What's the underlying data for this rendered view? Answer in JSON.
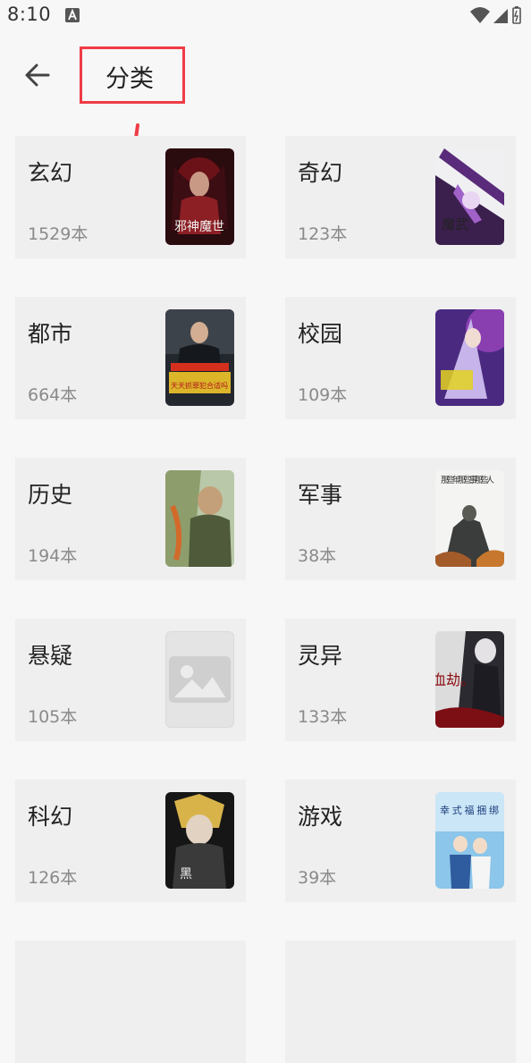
{
  "status_bar": {
    "time": "8:10",
    "icons": [
      "a-notification-icon",
      "wifi-icon",
      "signal-icon",
      "battery-icon"
    ]
  },
  "header": {
    "title": "分类",
    "back_icon": "arrow-left-icon"
  },
  "categories": [
    {
      "name": "玄幻",
      "count": "1529本",
      "cover_text": "邪神魔世"
    },
    {
      "name": "奇幻",
      "count": "123本",
      "cover_text": "魔武"
    },
    {
      "name": "都市",
      "count": "664本",
      "cover_text": "天天抓罪犯合适吗"
    },
    {
      "name": "校园",
      "count": "109本",
      "cover_text": ""
    },
    {
      "name": "历史",
      "count": "194本",
      "cover_text": ""
    },
    {
      "name": "军事",
      "count": "38本",
      "cover_text": "那些年那些事那些人"
    },
    {
      "name": "悬疑",
      "count": "105本",
      "cover_text": ""
    },
    {
      "name": "灵异",
      "count": "133本",
      "cover_text": "血劫。"
    },
    {
      "name": "科幻",
      "count": "126本",
      "cover_text": "黑"
    },
    {
      "name": "游戏",
      "count": "39本",
      "cover_text": "幸式福捆绑"
    }
  ],
  "colors": {
    "annotation_red": "#ef3c46",
    "card_bg": "#efefef",
    "page_bg": "#f7f7f7"
  }
}
